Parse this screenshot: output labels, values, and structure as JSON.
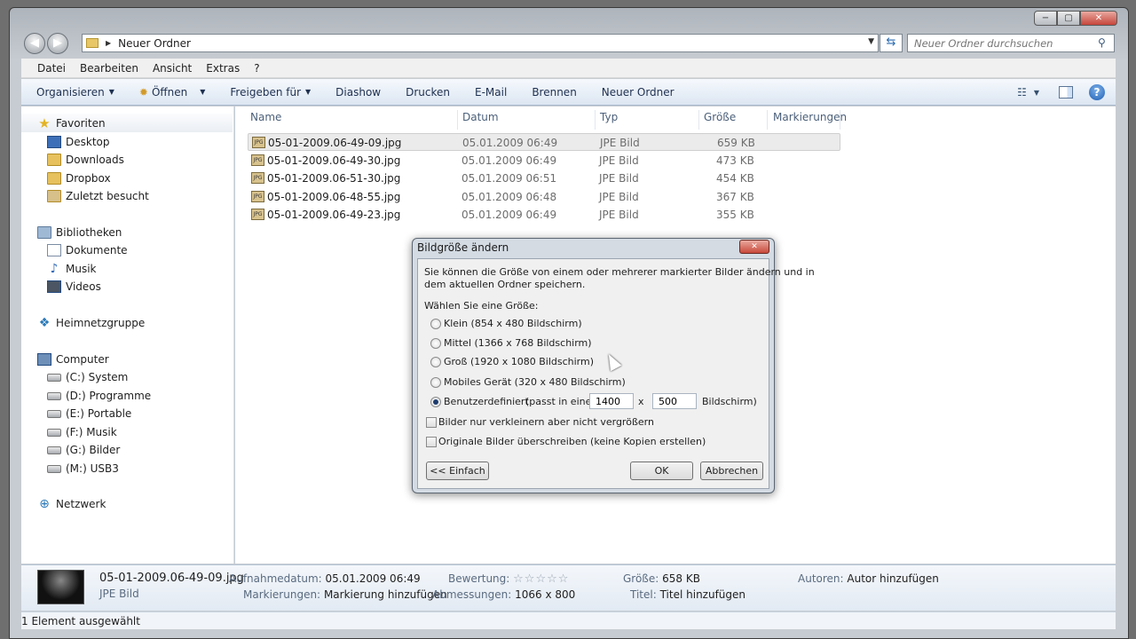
{
  "window": {
    "caption_buttons": [
      "−",
      "▢",
      "✕"
    ]
  },
  "address": {
    "path": "Neuer Ordner",
    "search_placeholder": "Neuer Ordner durchsuchen"
  },
  "menu": [
    "Datei",
    "Bearbeiten",
    "Ansicht",
    "Extras",
    "?"
  ],
  "toolbar": {
    "organize": "Organisieren",
    "open": "Öffnen",
    "share": "Freigeben für",
    "slideshow": "Diashow",
    "print": "Drucken",
    "email": "E-Mail",
    "burn": "Brennen",
    "new_folder": "Neuer Ordner"
  },
  "nav": {
    "favorites": "Favoriten",
    "desktop": "Desktop",
    "downloads": "Downloads",
    "dropbox": "Dropbox",
    "recent": "Zuletzt besucht",
    "libraries": "Bibliotheken",
    "documents": "Dokumente",
    "music": "Musik",
    "videos": "Videos",
    "homegroup": "Heimnetzgruppe",
    "computer": "Computer",
    "drive_c": "(C:) System",
    "drive_d": "(D:) Programme",
    "drive_e": "(E:) Portable",
    "drive_f": "(F:) Musik",
    "drive_g": "(G:) Bilder",
    "drive_m": "(M:) USB3",
    "network": "Netzwerk"
  },
  "columns": [
    "Name",
    "Datum",
    "Typ",
    "Größe",
    "Markierungen"
  ],
  "files": [
    {
      "name": "05-01-2009.06-49-09.jpg",
      "date": "05.01.2009 06:49",
      "type": "JPE Bild",
      "size": "659 KB"
    },
    {
      "name": "05-01-2009.06-49-30.jpg",
      "date": "05.01.2009 06:49",
      "type": "JPE Bild",
      "size": "473 KB"
    },
    {
      "name": "05-01-2009.06-51-30.jpg",
      "date": "05.01.2009 06:51",
      "type": "JPE Bild",
      "size": "454 KB"
    },
    {
      "name": "05-01-2009.06-48-55.jpg",
      "date": "05.01.2009 06:48",
      "type": "JPE Bild",
      "size": "367 KB"
    },
    {
      "name": "05-01-2009.06-49-23.jpg",
      "date": "05.01.2009 06:49",
      "type": "JPE Bild",
      "size": "355 KB"
    }
  ],
  "details": {
    "filename": "05-01-2009.06-49-09.jpg",
    "filetype": "JPE Bild",
    "date_label": "Aufnahmedatum:",
    "date_value": "05.01.2009 06:49",
    "tags_label": "Markierungen:",
    "tags_value": "Markierung hinzufügen",
    "rating_label": "Bewertung:",
    "dimensions_label": "Abmessungen:",
    "dimensions_value": "1066 x 800",
    "size_label": "Größe:",
    "size_value": "658 KB",
    "title_label": "Titel:",
    "title_value": "Titel hinzufügen",
    "authors_label": "Autoren:",
    "authors_value": "Autor hinzufügen",
    "rating_stars": 0
  },
  "status": "1 Element ausgewählt",
  "dialog": {
    "title": "Bildgröße ändern",
    "intro_line1": "Sie können die Größe von einem oder mehrerer markierter Bilder ändern und in",
    "intro_line2": "dem aktuellen Ordner speichern.",
    "choose_label": "Wählen Sie eine Größe:",
    "options": [
      "Klein (854 x 480 Bildschirm)",
      "Mittel (1366 x 768 Bildschirm)",
      "Groß (1920 x 1080 Bildschirm)",
      "Mobiles Gerät (320 x 480 Bildschirm)"
    ],
    "custom_label": "Benutzerdefiniert",
    "fit_label": "(passt in einen",
    "width_value": "1400",
    "times": "x",
    "height_value": "500",
    "screen_label": "Bildschirm)",
    "checkbox1": "Bilder nur verkleinern aber nicht vergrößern",
    "checkbox2": "Originale Bilder überschreiben (keine Kopien erstellen)",
    "simple_button": "<< Einfach",
    "ok_button": "OK",
    "cancel_button": "Abbrechen"
  }
}
